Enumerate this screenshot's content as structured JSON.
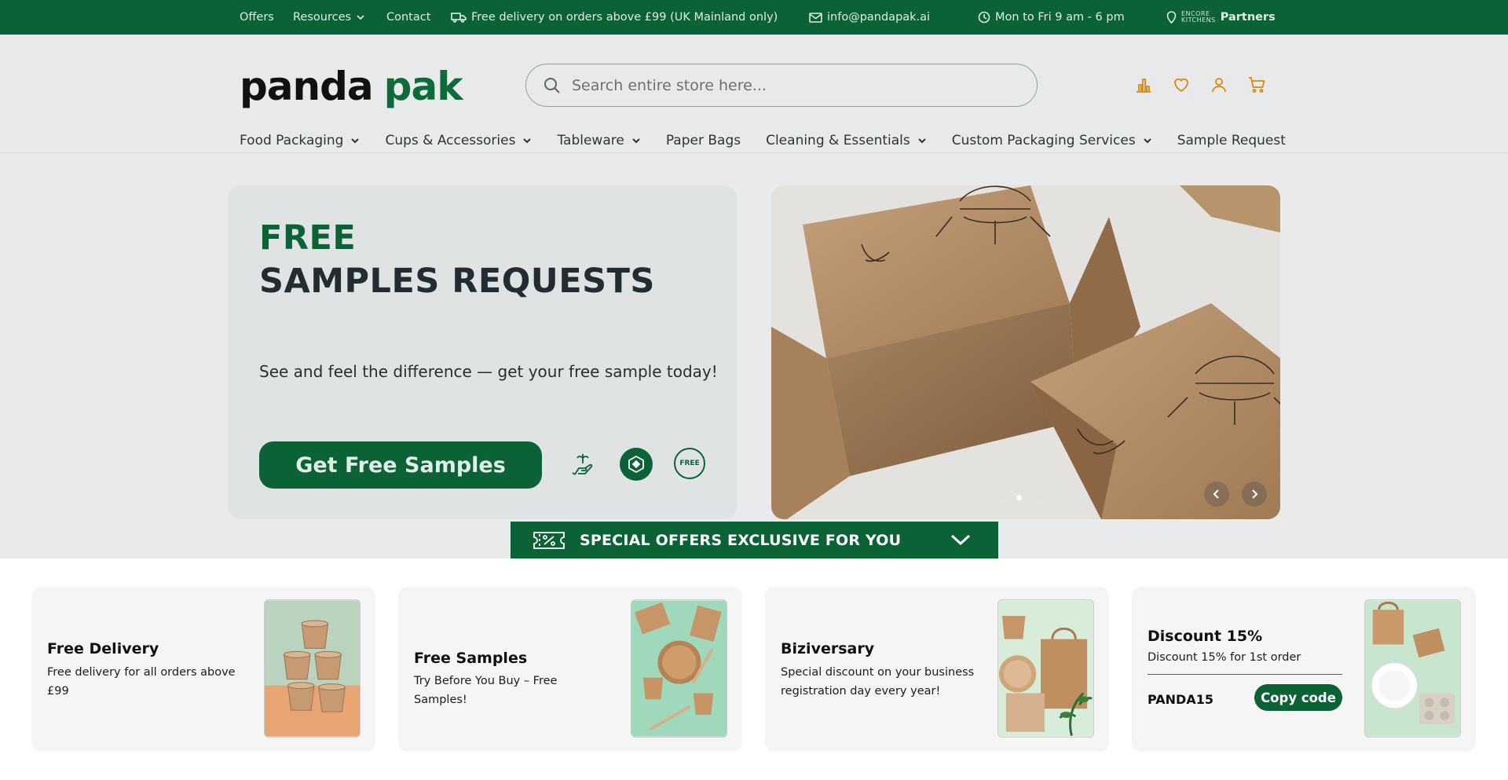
{
  "topbar": {
    "offers": "Offers",
    "resources": "Resources",
    "contact": "Contact",
    "delivery": "Free delivery on orders above £99 (UK Mainland only)",
    "email": "info@pandapak.ai",
    "hours": "Mon to Fri 9 am - 6 pm",
    "encore": "ENCORE",
    "kitchens": "KITCHENS",
    "partners": "Partners"
  },
  "header": {
    "logo_part1": "panda",
    "logo_part2": "pak",
    "search_placeholder": "Search entire store here...",
    "icons": [
      "compare-icon",
      "wishlist-icon",
      "account-icon",
      "cart-icon"
    ]
  },
  "nav": {
    "items": [
      {
        "label": "Food Packaging",
        "dropdown": true
      },
      {
        "label": "Cups & Accessories",
        "dropdown": true
      },
      {
        "label": "Tableware",
        "dropdown": true
      },
      {
        "label": "Paper Bags",
        "dropdown": false
      },
      {
        "label": "Cleaning & Essentials",
        "dropdown": true
      },
      {
        "label": "Custom Packaging Services",
        "dropdown": true
      },
      {
        "label": "Sample Request",
        "dropdown": false
      }
    ]
  },
  "hero": {
    "free": "FREE",
    "title": "SAMPLES REQUESTS",
    "subtitle": "See and feel the difference — get your free sample today!",
    "cta": "Get Free Samples",
    "badge_free": "FREE",
    "slider_dots": 3,
    "active_dot": 2
  },
  "offers_bar": {
    "label": "SPECIAL OFFERS EXCLUSIVE FOR YOU"
  },
  "cards": [
    {
      "title": "Free Delivery",
      "desc": "Free delivery for all orders above £99"
    },
    {
      "title": "Free Samples",
      "desc": "Try Before You Buy – Free Samples!"
    },
    {
      "title": "Biziversary",
      "desc": "Special discount on your business registration day every year!"
    },
    {
      "title": "Discount 15%",
      "desc": "Discount 15% for 1st order",
      "code": "PANDA15",
      "button": "Copy code"
    }
  ],
  "colors": {
    "brand_green": "#0b6237",
    "accent_orange": "#d9880f",
    "hero_bg": "#e9eaeb"
  }
}
